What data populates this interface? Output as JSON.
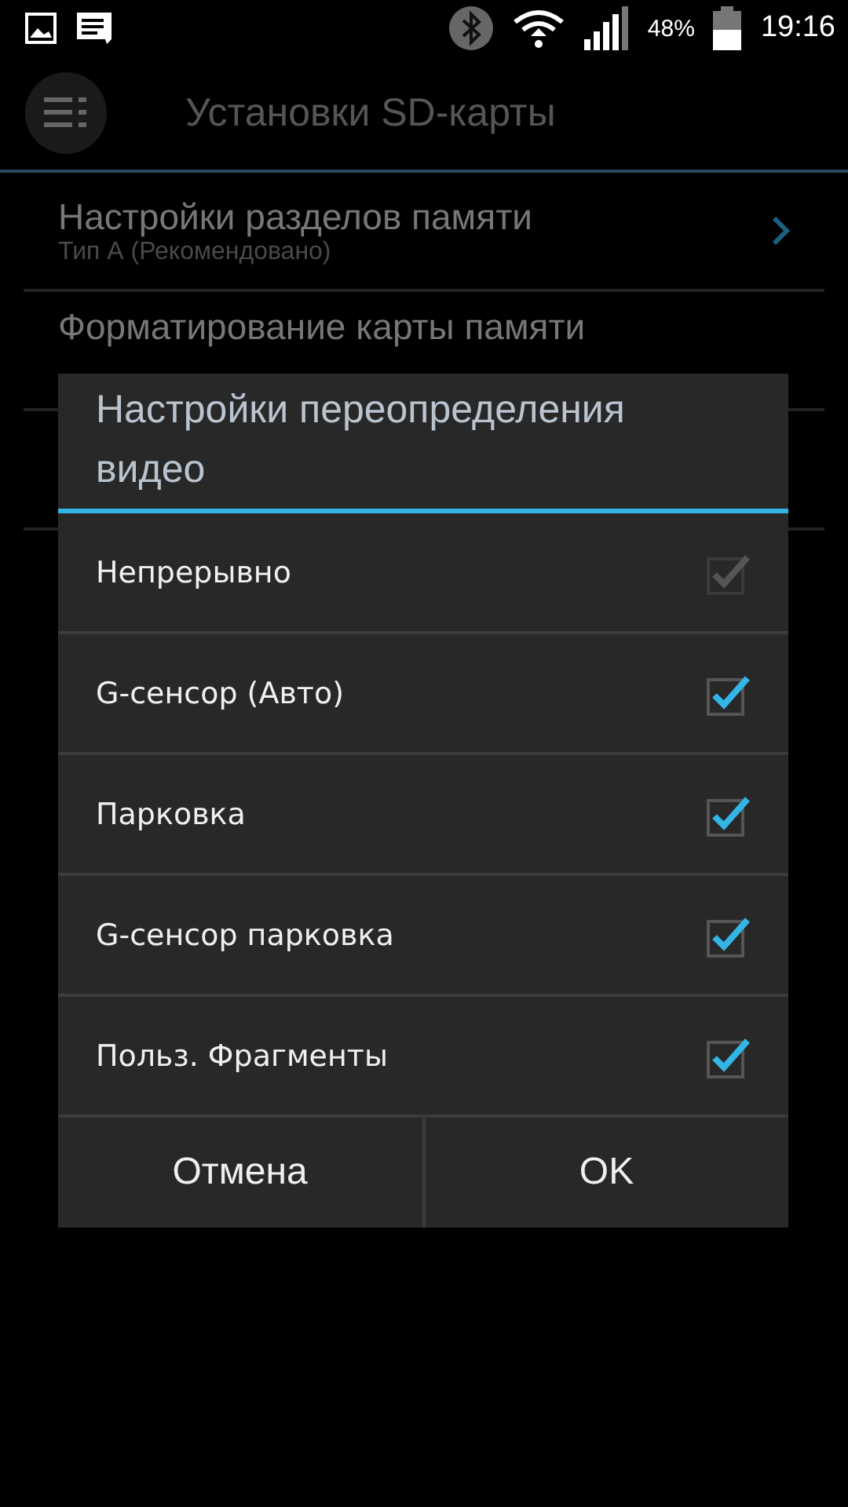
{
  "status_bar": {
    "battery": "48%",
    "time": "19:16"
  },
  "action_bar": {
    "title": "Установки SD-карты"
  },
  "settings": [
    {
      "title": "Настройки разделов памяти",
      "subtitle": "Тип А (Рекомендовано)"
    },
    {
      "title": "Форматирование карты памяти"
    }
  ],
  "dialog": {
    "title": "Настройки переопределения видео",
    "options": [
      {
        "label": "Непрерывно",
        "checked": true,
        "disabled": true
      },
      {
        "label": "G-сенсор (Авто)",
        "checked": true,
        "disabled": false
      },
      {
        "label": "Парковка",
        "checked": true,
        "disabled": false
      },
      {
        "label": "G-сенсор парковка",
        "checked": true,
        "disabled": false
      },
      {
        "label": "Польз. Фрагменты",
        "checked": true,
        "disabled": false
      }
    ],
    "buttons": [
      "Отмена",
      "OK"
    ]
  }
}
